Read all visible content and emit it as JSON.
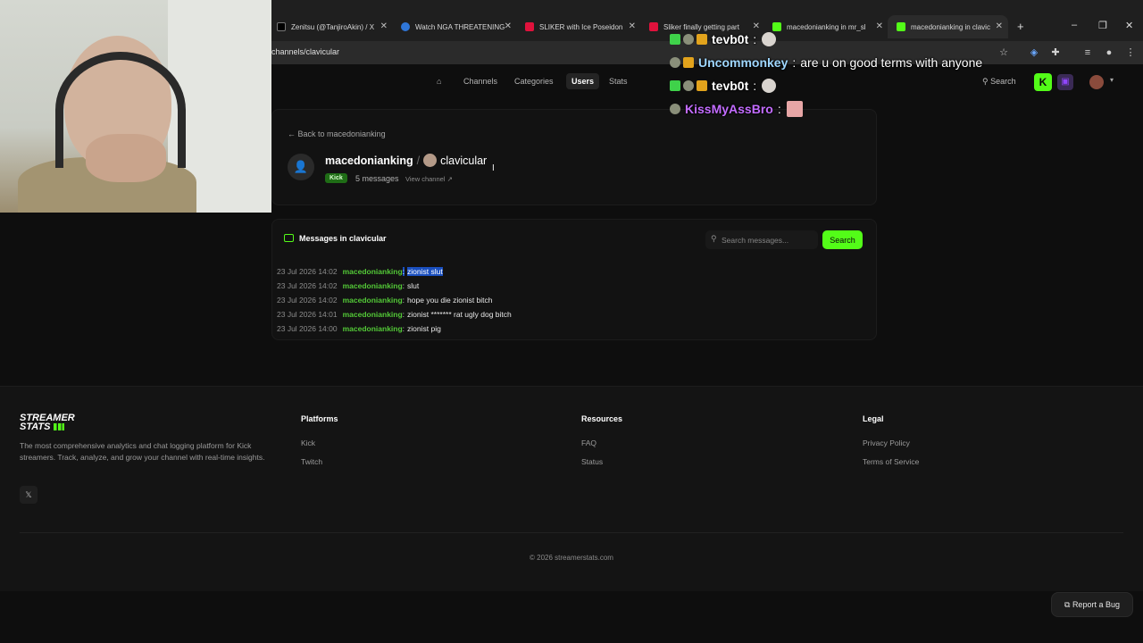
{
  "browser": {
    "tabs": [
      {
        "label": "Zenitsu (@TanjiroAkin) / X",
        "color": "#000000"
      },
      {
        "label": "Watch NGA THREATENING",
        "color": "#2f76d8"
      },
      {
        "label": "SLIKER with Ice Poseidon",
        "color": "#e0123c"
      },
      {
        "label": "Sliker finally getting part",
        "color": "#e0123c"
      },
      {
        "label": "macedonianking in mr_sl",
        "color": "#53fc18"
      },
      {
        "label": "macedonianking in clavic",
        "color": "#53fc18"
      }
    ],
    "url": "channels/clavicular"
  },
  "nav": {
    "items": [
      "Channels",
      "Categories",
      "Users",
      "Stats"
    ],
    "active": "Users",
    "search_label": "Search"
  },
  "channel": {
    "back_label": "Back to macedonianking",
    "user": "macedonianking",
    "separator": "/",
    "channel_name": "clavicular",
    "platform_badge": "Kick",
    "message_count": "5 messages",
    "view_channel": "View channel"
  },
  "messages": {
    "title": "Messages in clavicular",
    "search_placeholder": "Search messages...",
    "search_button": "Search",
    "rows": [
      {
        "ts": "23 Jul 2026 14:02",
        "author": "macedonianking",
        "text": "zionist slut"
      },
      {
        "ts": "23 Jul 2026 14:02",
        "author": "macedonianking",
        "text": "slut"
      },
      {
        "ts": "23 Jul 2026 14:02",
        "author": "macedonianking",
        "text": "hope you die zionist bitch"
      },
      {
        "ts": "23 Jul 2026 14:01",
        "author": "macedonianking",
        "text": "zionist ******* rat ugly dog bitch"
      },
      {
        "ts": "23 Jul 2026 14:00",
        "author": "macedonianking",
        "text": "zionist pig"
      }
    ]
  },
  "footer": {
    "logo_line1": "STREAMER",
    "logo_line2": "STATS",
    "tagline": "The most comprehensive analytics and chat logging platform for Kick streamers. Track, analyze, and grow your channel with real-time insights.",
    "platforms_title": "Platforms",
    "platforms": [
      "Kick",
      "Twitch"
    ],
    "resources_title": "Resources",
    "resources": [
      "FAQ",
      "Status"
    ],
    "legal_title": "Legal",
    "legal": [
      "Privacy Policy",
      "Terms of Service"
    ],
    "copyright": "© 2026 streamerstats.com",
    "report_bug": "Report a Bug"
  },
  "chat_overlay": [
    {
      "user": "tevb0t",
      "text": "",
      "color": "#ffffff"
    },
    {
      "user": "Uncommonkey",
      "text": "are u on good terms with anyone",
      "color": "#9fd7ff"
    },
    {
      "user": "tevb0t",
      "text": "",
      "color": "#ffffff"
    },
    {
      "user": "KissMyAssBro",
      "text": "",
      "color": "#c36cff"
    }
  ],
  "colors": {
    "accent": "#53fc18",
    "background": "#0e0e0e",
    "selection": "#1a4fbf"
  }
}
